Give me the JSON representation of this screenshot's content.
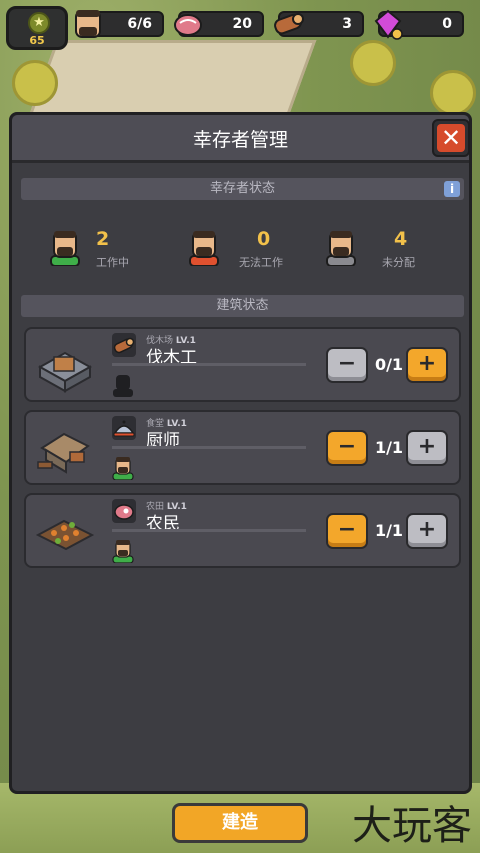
{
  "topbar": {
    "level": "65",
    "survivors": "6/6",
    "meat": "20",
    "wood": "3",
    "gems": "0"
  },
  "panel": {
    "title": "幸存者管理",
    "close_label": "✕",
    "survivor_status_title": "幸存者状态",
    "info_label": "i",
    "building_status_title": "建筑状态"
  },
  "stats": [
    {
      "value": "2",
      "label": "工作中",
      "shirt_color": "#3fae49"
    },
    {
      "value": "0",
      "label": "无法工作",
      "shirt_color": "#e0512f"
    },
    {
      "value": "4",
      "label": "未分配",
      "shirt_color": "#8a8a8f"
    }
  ],
  "buildings": [
    {
      "sub": "伐木场",
      "level": "LV.1",
      "name": "伐木工",
      "count": "0/1",
      "minus": "−",
      "plus": "+",
      "icon": "log-icon",
      "assigned": false
    },
    {
      "sub": "食堂",
      "level": "LV.1",
      "name": "厨师",
      "count": "1/1",
      "minus": "−",
      "plus": "+",
      "icon": "cloche-icon",
      "assigned": true
    },
    {
      "sub": "农田",
      "level": "LV.1",
      "name": "农民",
      "count": "1/1",
      "minus": "−",
      "plus": "+",
      "icon": "meat-icon",
      "assigned": true
    }
  ],
  "bottom": {
    "build_label": "建造"
  },
  "watermark": "大玩客"
}
